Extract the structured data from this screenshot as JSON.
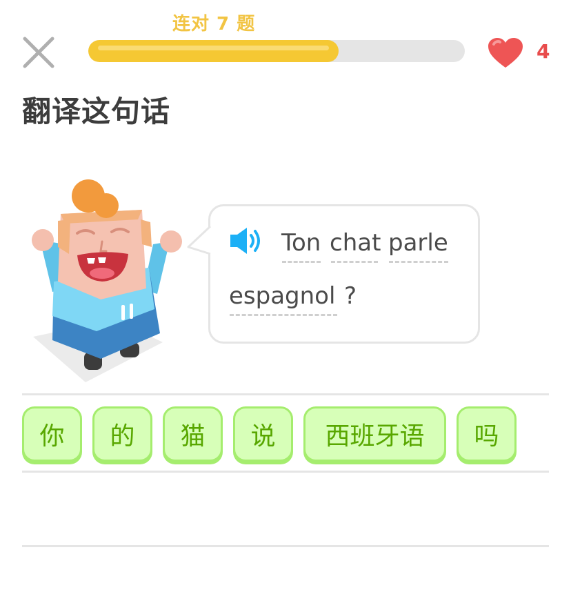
{
  "header": {
    "streak_label": "连对 7 题",
    "progress_fraction": 0.665,
    "hearts_count": "4"
  },
  "prompt": "翻译这句话",
  "bubble": {
    "words": [
      "Ton",
      "chat",
      "parle",
      "espagnol"
    ],
    "punctuation": "?"
  },
  "answer_chips": [
    "你",
    "的",
    "猫",
    "说",
    "西班牙语",
    "吗"
  ],
  "colors": {
    "progress": "#f5c833",
    "streak": "#f2c443",
    "heart": "#e84c4c",
    "chip_bg": "#d7ffb8",
    "chip_border": "#a5ed6e",
    "chip_text": "#58a700"
  },
  "icons": {
    "close": "close-icon",
    "heart": "heart-icon",
    "speaker": "speaker-icon"
  }
}
